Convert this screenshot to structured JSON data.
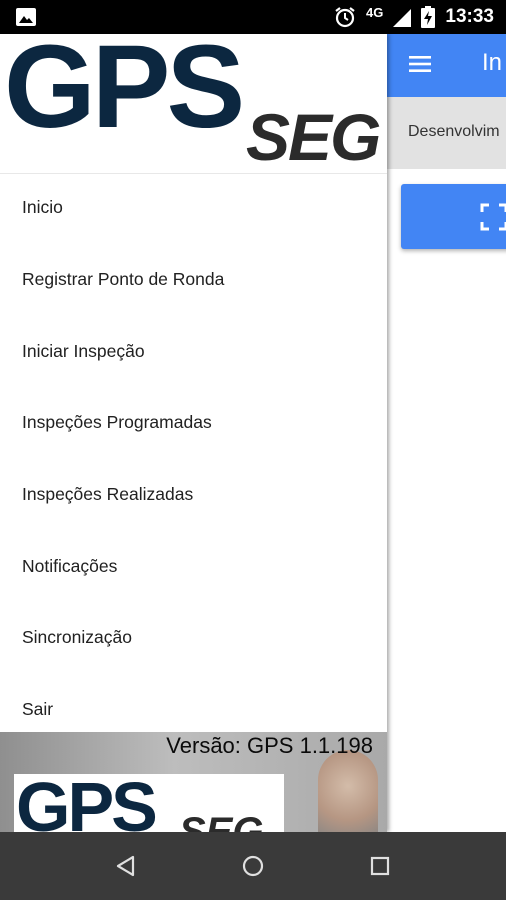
{
  "status_bar": {
    "time": "13:33",
    "network": "4G",
    "icons": [
      "image-notification-icon",
      "alarm-icon",
      "signal-icon",
      "battery-charging-icon"
    ]
  },
  "app": {
    "title": "In",
    "subtitle": "Desenvolvim",
    "colors": {
      "primary": "#4285f4",
      "subbar": "#e2e2e2"
    }
  },
  "drawer": {
    "logo": {
      "gps": "GPS",
      "seg": "SEG"
    },
    "menu": [
      {
        "label": "Inicio"
      },
      {
        "label": "Registrar Ponto de Ronda"
      },
      {
        "label": "Iniciar Inspeção"
      },
      {
        "label": "Inspeções Programadas"
      },
      {
        "label": "Inspeções Realizadas"
      },
      {
        "label": "Notificações"
      },
      {
        "label": "Sincronização"
      },
      {
        "label": "Sair"
      }
    ],
    "footer": {
      "version": "Versão: GPS 1.1.198",
      "logo": {
        "gps": "GPS",
        "seg": "SEG"
      }
    }
  },
  "nav_bar": {
    "buttons": [
      "back-icon",
      "home-icon",
      "recents-icon"
    ]
  }
}
